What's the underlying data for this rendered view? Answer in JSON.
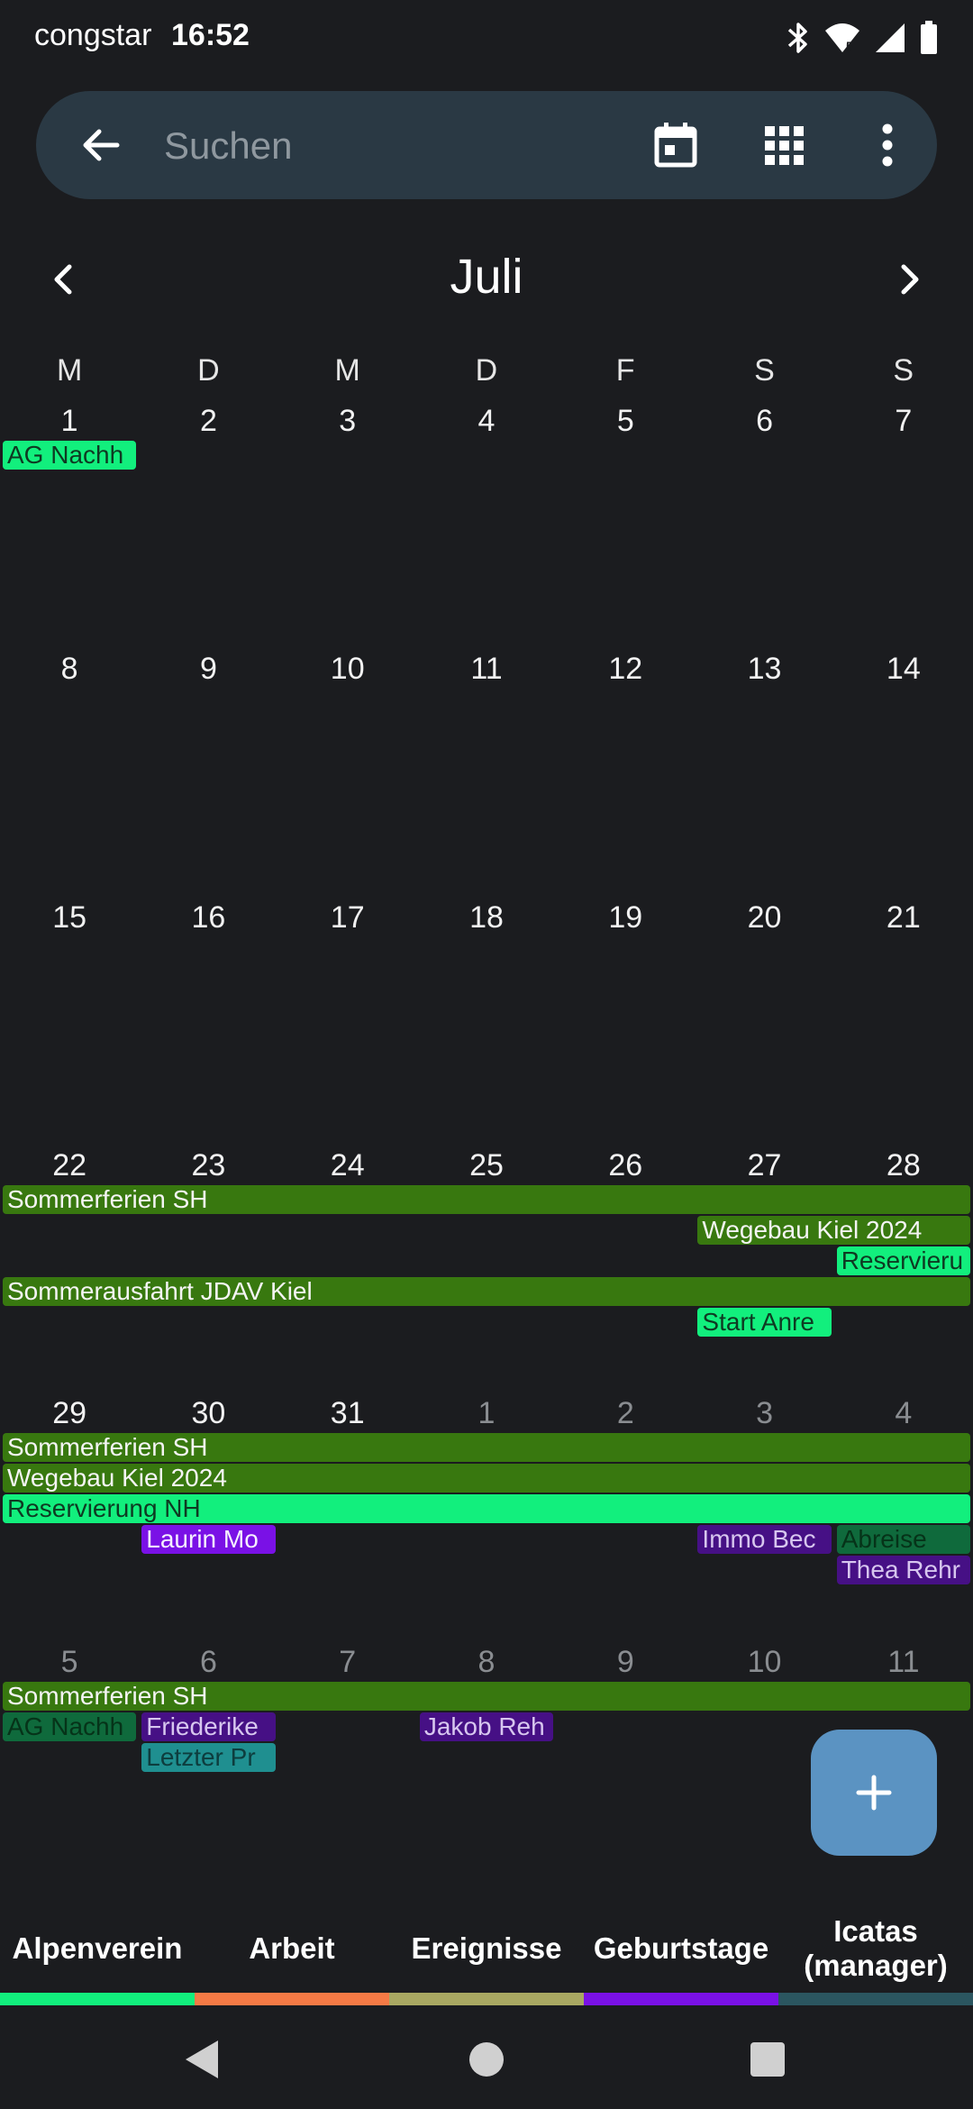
{
  "status_bar": {
    "carrier": "congstar",
    "time": "16:52",
    "icons": [
      "bluetooth-icon",
      "wifi-icon",
      "signal-icon",
      "battery-icon"
    ]
  },
  "search": {
    "placeholder": "Suchen",
    "icons": [
      "back-arrow-icon",
      "calendar-today-icon",
      "grid-view-icon",
      "more-vert-icon"
    ]
  },
  "month": {
    "title": "Juli"
  },
  "weekdays": [
    "M",
    "D",
    "M",
    "D",
    "F",
    "S",
    "S"
  ],
  "weeks": [
    {
      "days": [
        "1",
        "2",
        "3",
        "4",
        "5",
        "6",
        "7"
      ],
      "other": [
        false,
        false,
        false,
        false,
        false,
        false,
        false
      ],
      "events": [
        {
          "title": "AG Nachh",
          "start": 0,
          "span": 1,
          "row": 0,
          "style": "mint"
        }
      ]
    },
    {
      "days": [
        "8",
        "9",
        "10",
        "11",
        "12",
        "13",
        "14"
      ],
      "other": [
        false,
        false,
        false,
        false,
        false,
        false,
        false
      ],
      "events": []
    },
    {
      "days": [
        "15",
        "16",
        "17",
        "18",
        "19",
        "20",
        "21"
      ],
      "other": [
        false,
        false,
        false,
        false,
        false,
        false,
        false
      ],
      "events": []
    },
    {
      "days": [
        "22",
        "23",
        "24",
        "25",
        "26",
        "27",
        "28"
      ],
      "other": [
        false,
        false,
        false,
        false,
        false,
        false,
        false
      ],
      "events": [
        {
          "title": "Sommerferien SH",
          "start": 0,
          "span": 7,
          "row": 0,
          "style": "green"
        },
        {
          "title": "Wegebau Kiel 2024",
          "start": 5,
          "span": 2,
          "row": 1,
          "style": "green"
        },
        {
          "title": "Reservieru",
          "start": 6,
          "span": 1,
          "row": 2,
          "style": "mint"
        },
        {
          "title": "Sommerausfahrt JDAV Kiel",
          "start": 0,
          "span": 7,
          "row": 3,
          "style": "green"
        },
        {
          "title": "Start Anre",
          "start": 5,
          "span": 1,
          "row": 4,
          "style": "mint"
        }
      ]
    },
    {
      "days": [
        "29",
        "30",
        "31",
        "1",
        "2",
        "3",
        "4"
      ],
      "other": [
        false,
        false,
        false,
        true,
        true,
        true,
        true
      ],
      "events": [
        {
          "title": "Sommerferien SH",
          "start": 0,
          "span": 7,
          "row": 0,
          "style": "green"
        },
        {
          "title": "Wegebau Kiel 2024",
          "start": 0,
          "span": 7,
          "row": 1,
          "style": "green"
        },
        {
          "title": "Reservierung NH",
          "start": 0,
          "span": 7,
          "row": 2,
          "style": "mint"
        },
        {
          "title": "Laurin Mo",
          "start": 1,
          "span": 1,
          "row": 3,
          "style": "purple"
        },
        {
          "title": "Immo Bec",
          "start": 5,
          "span": 1,
          "row": 3,
          "style": "purpledim"
        },
        {
          "title": "Abreise",
          "start": 6,
          "span": 1,
          "row": 3,
          "style": "mintdim"
        },
        {
          "title": "Thea Rehr",
          "start": 6,
          "span": 1,
          "row": 4,
          "style": "purpledim"
        }
      ]
    },
    {
      "days": [
        "5",
        "6",
        "7",
        "8",
        "9",
        "10",
        "11"
      ],
      "other": [
        true,
        true,
        true,
        true,
        true,
        true,
        true
      ],
      "events": [
        {
          "title": "Sommerferien SH",
          "start": 0,
          "span": 7,
          "row": 0,
          "style": "green"
        },
        {
          "title": "AG Nachh",
          "start": 0,
          "span": 1,
          "row": 1,
          "style": "mintdim"
        },
        {
          "title": "Friederike",
          "start": 1,
          "span": 1,
          "row": 1,
          "style": "purpledim"
        },
        {
          "title": "Jakob Reh",
          "start": 3,
          "span": 1,
          "row": 1,
          "style": "purpledim"
        },
        {
          "title": "Letzter Pr",
          "start": 1,
          "span": 1,
          "row": 2,
          "style": "teal"
        }
      ]
    }
  ],
  "fab": {
    "icon": "plus-icon"
  },
  "tabs": [
    {
      "label": "Alpenverein",
      "color": "#12ef7d"
    },
    {
      "label": "Arbeit",
      "color": "#f57a45"
    },
    {
      "label": "Ereignisse",
      "color": "#a9a862"
    },
    {
      "label": "Geburtstage",
      "color": "#7a11e6"
    },
    {
      "label": "Icatas (manager)",
      "color": "#2b5660"
    }
  ],
  "nav": {
    "icons": [
      "back-triangle-icon",
      "home-circle-icon",
      "recents-square-icon"
    ]
  }
}
